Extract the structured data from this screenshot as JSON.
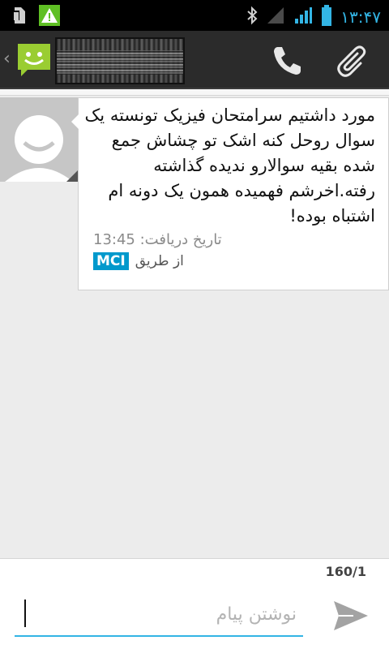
{
  "status_bar": {
    "time": "۱۳:۴۷",
    "icons": [
      "sim-card-icon",
      "warning-icon",
      "bluetooth-icon",
      "signal-icon",
      "signal-icon",
      "battery-icon"
    ]
  },
  "action_bar": {
    "icons": [
      "up-caret-icon",
      "messaging-app-icon",
      "contact-photo",
      "phone-icon",
      "paperclip-icon"
    ],
    "up_caret": "‹"
  },
  "message": {
    "body": "مورد داشتیم سرامتحان فیزیک تونسته یک سوال روحل کنه اشک تو چشاش جمع شده بقیه سوالارو ندیده گذاشته رفته.اخرشم فهمیده همون یک دونه ام اشتباه بوده!",
    "received_label": "تاریخ دریافت:",
    "received_time": "13:45",
    "carrier": "MCI",
    "via_label": "از طریق"
  },
  "compose": {
    "counter": "160/1",
    "placeholder": "نوشتن پیام",
    "value": ""
  },
  "colors": {
    "accent": "#33b5e5",
    "carrier_badge": "#0099cc",
    "app_icon": "#9acd32"
  }
}
